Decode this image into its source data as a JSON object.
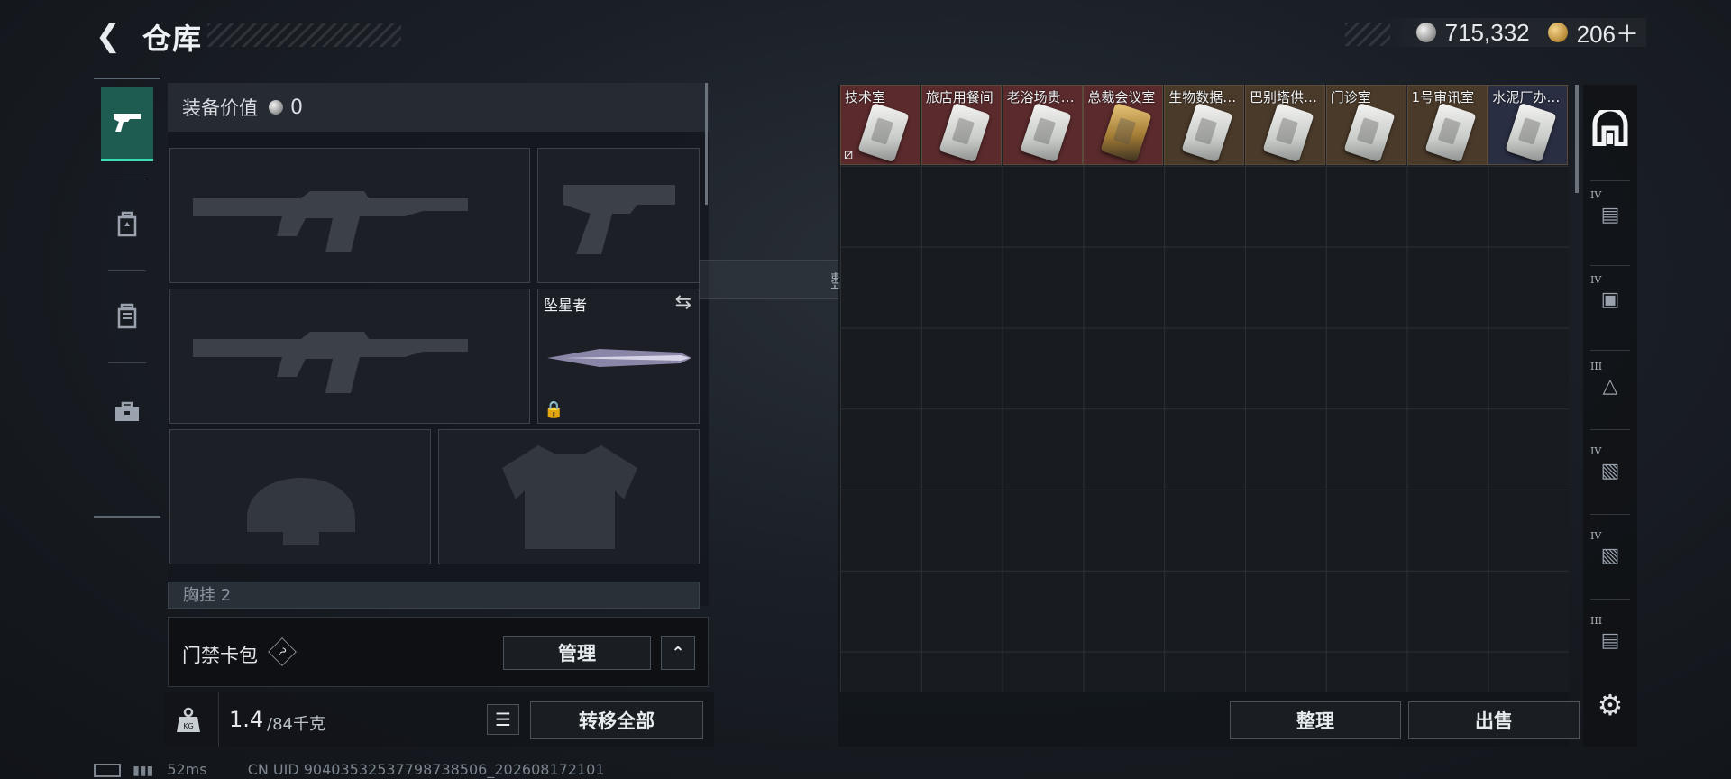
{
  "header": {
    "back_icon": "chevron-left-icon",
    "title": "仓库",
    "silver_amount": "715,332",
    "gold_amount": "206＋"
  },
  "nav": {
    "items": [
      {
        "icon": "pistol-icon",
        "active": true
      },
      {
        "icon": "backpack-icon",
        "active": false
      },
      {
        "icon": "vest-icon",
        "active": false
      },
      {
        "icon": "toolbox-icon",
        "active": false
      }
    ]
  },
  "equipment": {
    "value_label": "装备价值",
    "value_amount": "0",
    "melee_name": "坠星者",
    "pocket_label": "胸挂",
    "pocket_count": "2"
  },
  "card_bag": {
    "label": "门禁卡包",
    "help": "?",
    "manage_label": "管理"
  },
  "weight": {
    "current": "1.4",
    "max": "/84千克",
    "transfer_all": "转移全部"
  },
  "status_bar": {
    "ping": "52ms",
    "uid": "CN UID 9040353253779873850​6_202608172101"
  },
  "toast": "整理成功",
  "storage": {
    "cards": [
      {
        "label": "技术室",
        "bg": "#5a2a2c",
        "gold": false
      },
      {
        "label": "旅店用餐间",
        "bg": "#5a2a2c",
        "gold": false
      },
      {
        "label": "老浴场贵…",
        "bg": "#5a2a2c",
        "gold": false
      },
      {
        "label": "总裁会议室",
        "bg": "#5a2a2c",
        "gold": true
      },
      {
        "label": "生物数据…",
        "bg": "#4a3a2a",
        "gold": false
      },
      {
        "label": "巴别塔供…",
        "bg": "#4a3a2a",
        "gold": false
      },
      {
        "label": "门诊室",
        "bg": "#4a3a2a",
        "gold": false
      },
      {
        "label": "1号审讯室",
        "bg": "#4a3a2a",
        "gold": false
      },
      {
        "label": "水泥厂办…",
        "bg": "#2a2e42",
        "gold": false
      }
    ],
    "sort_label": "整理",
    "sell_label": "出售"
  },
  "sidebar": {
    "tiers": [
      "IV",
      "IV",
      "III",
      "IV",
      "IV",
      "III"
    ]
  }
}
